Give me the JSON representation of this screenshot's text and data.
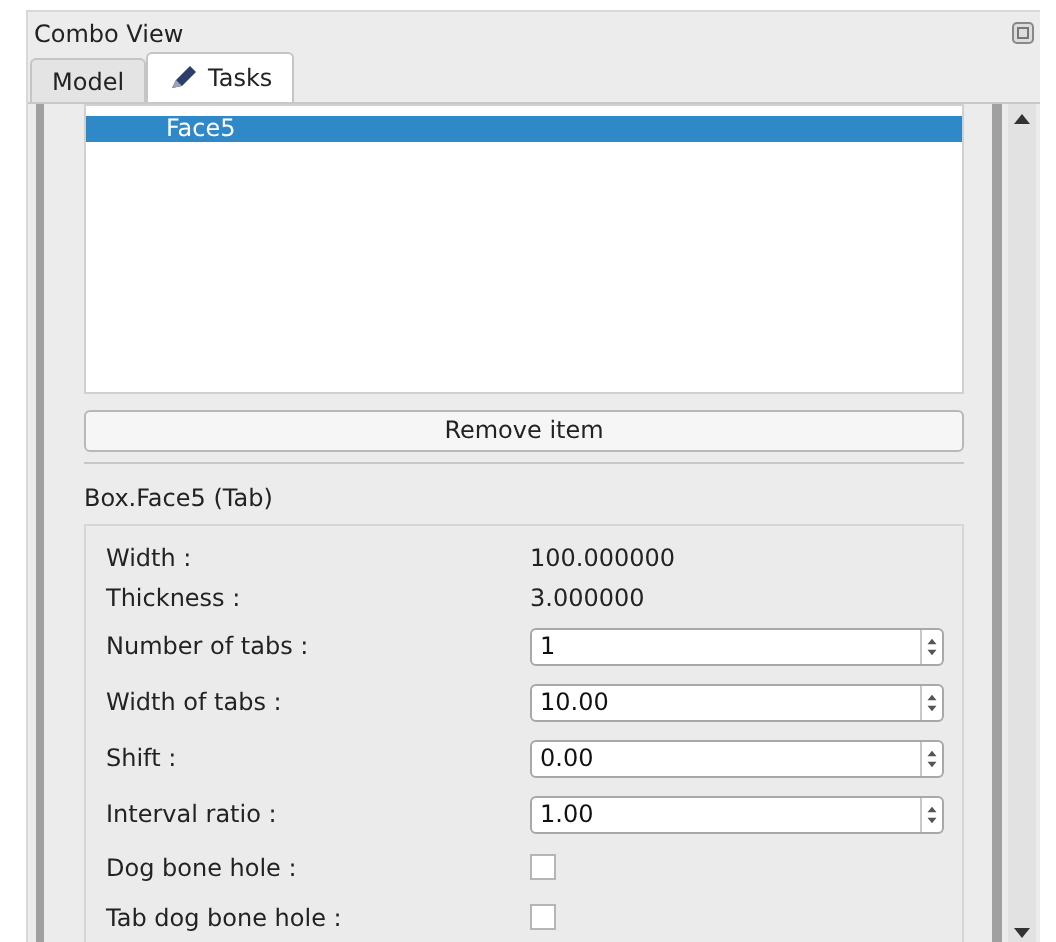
{
  "panel": {
    "title": "Combo View"
  },
  "tabs": [
    {
      "label": "Model",
      "selected": false,
      "icon": false
    },
    {
      "label": "Tasks",
      "selected": true,
      "icon": true
    }
  ],
  "list": {
    "items": [
      {
        "label": "Face5",
        "selected": true
      }
    ]
  },
  "remove_button": "Remove item",
  "group": {
    "title": "Box.Face5 (Tab)",
    "rows": [
      {
        "kind": "value",
        "label": "Width :",
        "value": "100.000000"
      },
      {
        "kind": "value",
        "label": "Thickness :",
        "value": "3.000000"
      },
      {
        "kind": "spin",
        "label": "Number of tabs :",
        "value": "1"
      },
      {
        "kind": "spin",
        "label": "Width of tabs :",
        "value": "10.00"
      },
      {
        "kind": "spin",
        "label": "Shift :",
        "value": "0.00"
      },
      {
        "kind": "spin",
        "label": "Interval ratio :",
        "value": "1.00"
      },
      {
        "kind": "check",
        "label": "Dog bone hole :",
        "checked": false
      },
      {
        "kind": "check",
        "label": "Tab dog bone hole :",
        "checked": false
      }
    ]
  }
}
